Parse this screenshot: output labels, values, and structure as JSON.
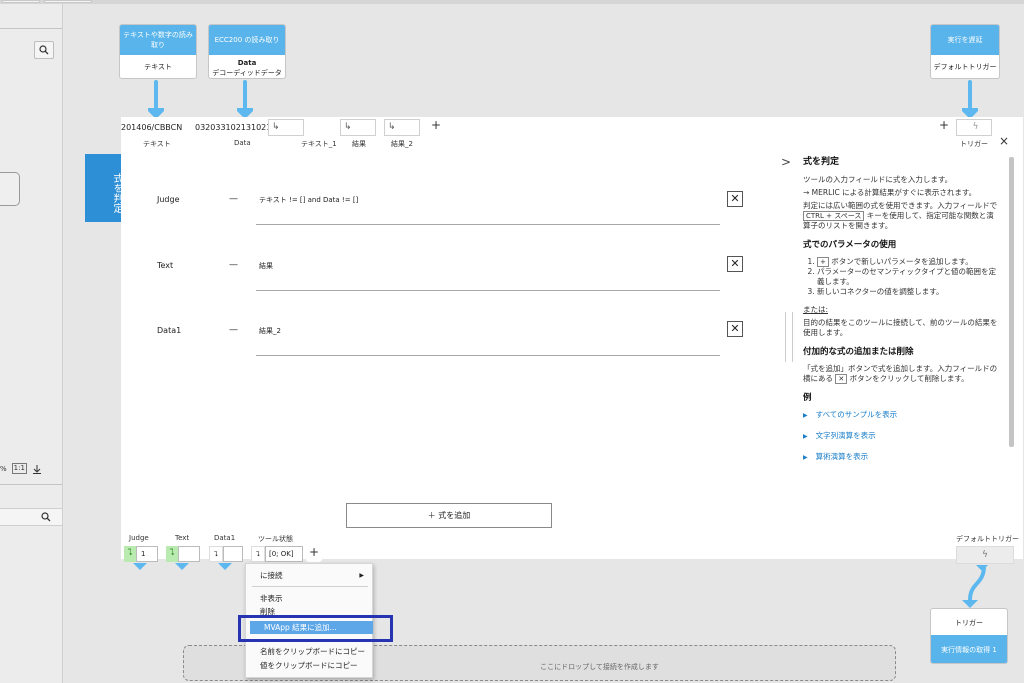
{
  "colors": {
    "accent": "#2d8fd5",
    "node_header": "#58b4ea",
    "highlight": "#5da7e8",
    "focus_box": "#2734b2",
    "ok_green": "#b9eab0"
  },
  "left_panel": {
    "zoom_suffix": "%",
    "zoom_fit_label": "1:1"
  },
  "nodes": {
    "ocr": {
      "header": "テキストや数字の読み取り",
      "body": "テキスト"
    },
    "ecc": {
      "header": "ECC200 の読み取り",
      "body_bold": "Data",
      "body": "デコーディッドデータ"
    },
    "delay": {
      "header": "実行を遅延",
      "body": "デフォルトトリガー"
    },
    "fetch": {
      "body": "トリガー",
      "footer": "実行情報の取得 1"
    }
  },
  "tool": {
    "side_tab": "式を判定",
    "inputs": {
      "values": [
        "201406/CBBCN",
        "03203310213102112322"
      ],
      "labels": [
        "テキスト",
        "Data",
        "テキスト_1",
        "結果",
        "結果_2"
      ],
      "slot_glyph": "↳",
      "trigger_label": "トリガー",
      "trigger_glyph": "ϟ"
    },
    "expressions": [
      {
        "label": "Judge",
        "value": "テキスト != [] and Data != []"
      },
      {
        "label": "Text",
        "value": "結果"
      },
      {
        "label": "Data1",
        "value": "結果_2"
      }
    ],
    "dash": "—",
    "remove_glyph": "✕",
    "add_expression": "＋ 式を追加",
    "outputs": {
      "labels": [
        "Judge",
        "Text",
        "Data1",
        "ツール状態"
      ],
      "judge_value": "1",
      "state_value": "[0; OK]",
      "out_glyph": "⮧",
      "default_trigger_label": "デフォルトトリガー"
    },
    "close_glyph": "×",
    "collapse_glyph": ">"
  },
  "help": {
    "title": "式を判定",
    "intro1": "ツールの入力フィールドに式を入力します。",
    "intro2": "→ MERLIC による計算結果がすぐに表示されます。",
    "intro3": "判定には広い範囲の式を使用できます。入力フィールドで",
    "kbd": "CTRL + スペース",
    "intro4": "キーを使用して、指定可能な関数と演算子のリストを開きます。",
    "params_title": "式でのパラメータの使用",
    "steps": [
      "ボタンで新しいパラメータを追加します。",
      "パラメーターのセマンティックタイプと値の範囲を定義します。",
      "新しいコネクターの値を調整します。"
    ],
    "or": "または:",
    "or_text": "目的の結果をこのツールに接続して、前のツールの結果を使用します。",
    "add_remove_title": "付加的な式の追加または削除",
    "add_remove_text1": "「式を追加」ボタンで式を追加します。入力フィールドの横にある",
    "add_remove_text2": "ボタンをクリックして削除します。",
    "examples_title": "例",
    "links": [
      "すべてのサンプルを表示",
      "文字列演算を表示",
      "算術演算を表示"
    ]
  },
  "context_menu": {
    "connect": "に接続",
    "hide": "非表示",
    "delete": "削除",
    "add_mvapp": "MVApp 結果に追加...",
    "copy_name": "名前をクリップボードにコピー",
    "copy_value": "値をクリップボードにコピー"
  },
  "drop_zone": "ここにドロップして接続を作成します"
}
